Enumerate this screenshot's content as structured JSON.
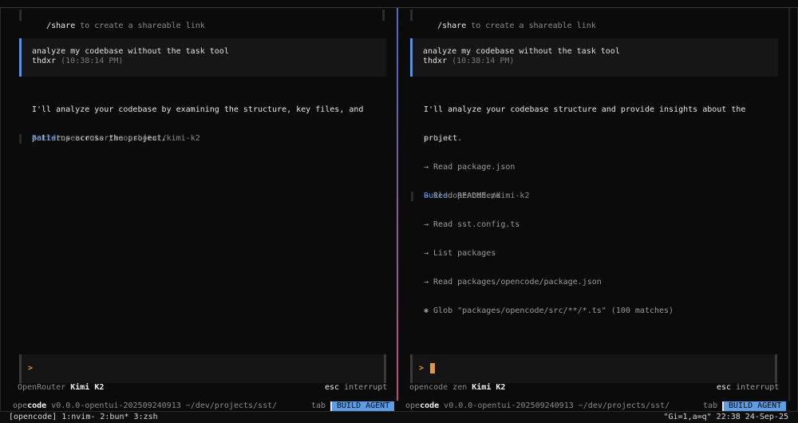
{
  "left": {
    "share": {
      "cmd": "/share",
      "rest": " to create a shareable link"
    },
    "message": {
      "text": "analyze my codebase without the task tool",
      "user": "thdxr",
      "time": "(10:38:14 PM)"
    },
    "response": [
      "I'll analyze your codebase by examining the structure, key files, and",
      "patterns across the project."
    ],
    "tools": [
      "→ List ."
    ],
    "build": {
      "label": "Build",
      "model": "openrouter/moonshotai/kimi-k2"
    },
    "input": {
      "prompt": ">"
    },
    "provider": {
      "name": "OpenRouter",
      "model": "Kimi K2"
    },
    "esc": {
      "key": "esc",
      "action": "interrupt"
    },
    "status": {
      "op": "ope",
      "code": "code",
      "rest": " v0.0.0-opentui-202509240913 ~/dev/projects/sst/",
      "tab": "tab",
      "agent": "BUILD AGENT"
    }
  },
  "right": {
    "share": {
      "cmd": "/share",
      "rest": " to create a shareable link"
    },
    "message": {
      "text": "analyze my codebase without the task tool",
      "user": "thdxr",
      "time": "(10:38:14 PM)"
    },
    "response": [
      "I'll analyze your codebase structure and provide insights about the",
      "project."
    ],
    "tools": [
      "→ List .",
      "→ Read package.json",
      "→ Read README.md",
      "→ Read sst.config.ts",
      "→ List packages",
      "→ Read packages/opencode/package.json",
      "✱ Glob \"packages/opencode/src/**/*.ts\" (100 matches)"
    ],
    "build": {
      "label": "Build",
      "model": "opencode/kimi-k2"
    },
    "input": {
      "prompt": ">"
    },
    "provider": {
      "name": "opencode zen",
      "model": "Kimi K2"
    },
    "esc": {
      "key": "esc",
      "action": "interrupt"
    },
    "status": {
      "op": "ope",
      "code": "code",
      "rest": " v0.0.0-opentui-202509240913 ~/dev/projects/sst/",
      "tab": "tab",
      "agent": "BUILD AGENT"
    }
  },
  "tmux": {
    "left": "[opencode] 1:nvim- 2:bun* 3:zsh",
    "right": "\"Gi=1,a=q\" 22:38 24-Sep-25"
  },
  "colors": {
    "accent": "#5b8fe0",
    "prompt": "#e0964a",
    "agent_bg": "#5b9ee8"
  }
}
